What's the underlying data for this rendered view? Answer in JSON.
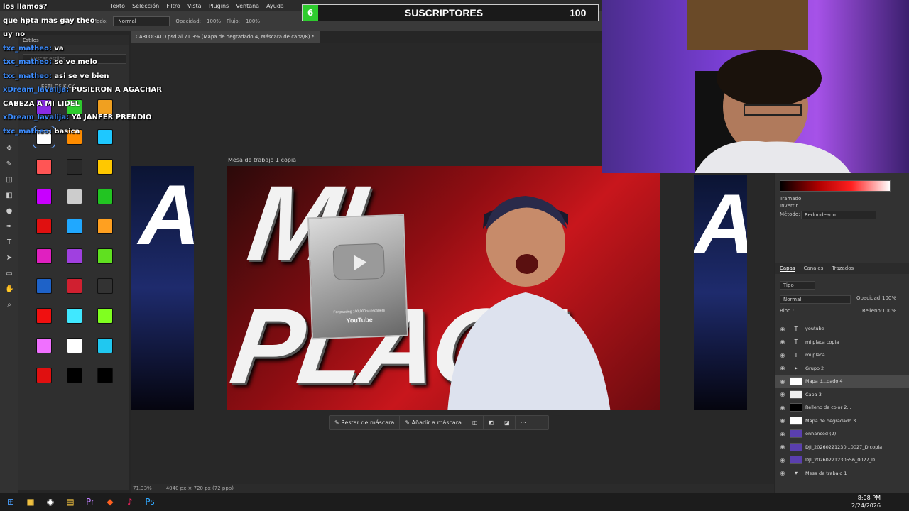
{
  "menubar": {
    "items": [
      "Texto",
      "Selección",
      "Filtro",
      "Vista",
      "Plugins",
      "Ventana",
      "Ayuda"
    ]
  },
  "options": {
    "mode_label": "Modo:",
    "mode_value": "Normal",
    "opacity_label": "Opacidad:",
    "opacity_value": "100%",
    "flow_label": "Flujo:",
    "flow_value": "100%"
  },
  "document": {
    "tab_title": "CARLOGATO.psd al 71.3% (Mapa de degradado 4, Máscara de capa/8) *",
    "artboard_label": "Mesa de trabajo 1 copia"
  },
  "styles_panel": {
    "title": "Estilos",
    "search_placeholder": "Buscar estilos",
    "group_name": "ESTILOS KICK",
    "swatches": [
      "#8a2be2",
      "#2ecc2e",
      "#f0a020",
      "#ffffff",
      "#ff8c00",
      "#1ec8ff",
      "#ff5555",
      "#2a2a2a",
      "#ffc800",
      "#c800ff",
      "#cccccc",
      "#22c422",
      "#e01010",
      "#20a8ff",
      "#ffa020",
      "#e020c0",
      "#a040e0",
      "#60e020",
      "#1e62c8",
      "#d02030",
      "#333333",
      "#f01010",
      "#40e8ff",
      "#80ff20",
      "#f070ff",
      "#ffffff",
      "#20c8f0",
      "#e01010",
      "#000000",
      "#000000",
      "#000000",
      "#000000",
      "#000000"
    ]
  },
  "chat": [
    {
      "user": "",
      "text": "los llamos?"
    },
    {
      "user": "",
      "text": "que hpta mas gay theo"
    },
    {
      "user": "",
      "text": "uy no"
    },
    {
      "user": "txc_matheo:",
      "text": "va"
    },
    {
      "user": "txc_matheo:",
      "text": "se ve melo"
    },
    {
      "user": "txc_matheo:",
      "text": "asi se ve bien"
    },
    {
      "user": "xDream_lavalija:",
      "text": "PUSIERON A AGACHAR"
    },
    {
      "user": "",
      "text": "CABEZA A MI LIDEL"
    },
    {
      "user": "xDream_lavalija:",
      "text": "YA JANFER PRENDIO"
    },
    {
      "user": "txc_matheo:",
      "text": "basica"
    }
  ],
  "subgoal": {
    "current": "6",
    "label": "SUSCRIPTORES",
    "goal": "100"
  },
  "thumbnail": {
    "title": "MI PLACA",
    "plaque_brand": "YouTube",
    "plaque_caption": "For passing 100,000 subscribers"
  },
  "side_left_text": "A",
  "side_right_text": "A",
  "context_bar": {
    "reset_mask": "Restar de máscara",
    "add_mask": "Añadir a máscara"
  },
  "status": {
    "zoom": "71.33%",
    "dimensions": "4040 px × 720 px (72 ppp)"
  },
  "properties": {
    "dither": "Tramado",
    "invert": "Invertir",
    "method_label": "Método:",
    "method_value": "Redondeado"
  },
  "layers_panel": {
    "tabs": [
      "Capas",
      "Canales",
      "Trazados"
    ],
    "filter": "Tipo",
    "blend": "Normal",
    "opacity_label": "Opacidad:",
    "opacity_value": "100%",
    "lock_label": "Bloq.:",
    "fill_label": "Relleno:",
    "fill_value": "100%",
    "layers": [
      "youtube",
      "mi placa copia",
      "mi placa",
      "Grupo 2",
      "Mapa d...dado 4",
      "Capa 3",
      "Relleno de color 2...",
      "Mapa de degradado 3",
      "enhanced (2)",
      "DJI_20260221230...0027_D copia",
      "DJI_20260221230556_0027_D",
      "Mesa de trabajo 1"
    ]
  },
  "clock": {
    "time": "8:08 PM",
    "date": "2/24/2026"
  },
  "colors": {
    "accent": "#2ecc2e",
    "chat_user": "#3d8dff",
    "artboard_red": "#c8161c"
  }
}
